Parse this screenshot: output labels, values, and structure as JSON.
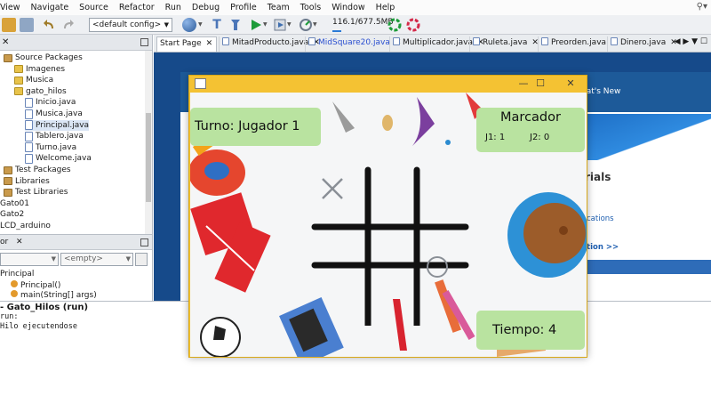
{
  "menu": [
    "View",
    "Navigate",
    "Source",
    "Refactor",
    "Run",
    "Debug",
    "Profile",
    "Team",
    "Tools",
    "Window",
    "Help"
  ],
  "toolbar": {
    "config": "<default config>",
    "memory": "116.1/677.5MB",
    "memory_fraction": 0.17
  },
  "projects_tree": [
    {
      "label": "Source Packages",
      "indent": 0,
      "icon": "folder-icon"
    },
    {
      "label": "Imagenes",
      "indent": 1,
      "icon": "package-icon"
    },
    {
      "label": "Musica",
      "indent": 1,
      "icon": "package-icon"
    },
    {
      "label": "gato_hilos",
      "indent": 1,
      "icon": "package-icon"
    },
    {
      "label": "Inicio.java",
      "indent": 2,
      "icon": "java-file-icon"
    },
    {
      "label": "Musica.java",
      "indent": 2,
      "icon": "java-file-icon"
    },
    {
      "label": "Principal.java",
      "indent": 2,
      "icon": "java-file-icon",
      "selected": true
    },
    {
      "label": "Tablero.java",
      "indent": 2,
      "icon": "java-file-icon"
    },
    {
      "label": "Turno.java",
      "indent": 2,
      "icon": "java-file-icon"
    },
    {
      "label": "Welcome.java",
      "indent": 2,
      "icon": "java-file-icon"
    },
    {
      "label": "Test Packages",
      "indent": 0,
      "icon": "folder-icon"
    },
    {
      "label": "Libraries",
      "indent": 0,
      "icon": "library-icon"
    },
    {
      "label": "Test Libraries",
      "indent": 0,
      "icon": "library-icon"
    },
    {
      "label": "Gato01",
      "indent": -1,
      "icon": ""
    },
    {
      "label": "Gato2",
      "indent": -1,
      "icon": ""
    },
    {
      "label": "LCD_arduino",
      "indent": -1,
      "icon": ""
    }
  ],
  "navigator": {
    "tab": "or",
    "filter": "<empty>",
    "items": [
      "Principal",
      "Principal()",
      "main(String[] args)"
    ]
  },
  "output": {
    "title": "- Gato_Hilos (run)",
    "lines": [
      "run:",
      "Hilo ejecutendose"
    ]
  },
  "editor_tabs": [
    {
      "label": "Start Page",
      "active": true
    },
    {
      "label": "MitadProducto.java"
    },
    {
      "label": "MidSquare20.java",
      "highlight": true
    },
    {
      "label": "Multiplicador.java"
    },
    {
      "label": "Ruleta.java"
    },
    {
      "label": "Preorden.java"
    },
    {
      "label": "Dinero.java"
    }
  ],
  "start_page": {
    "whats_new": "hat's New",
    "tutorials": "rials",
    "link1": "cations",
    "link2": "tion >>"
  },
  "game": {
    "turno": "Turno:  Jugador 1",
    "marcador_title": "Marcador",
    "j1": "J1:  1",
    "j2": "J2:  0",
    "tiempo": "Tiempo:  4",
    "board": [
      "X",
      "",
      "",
      "",
      "",
      "",
      "",
      "",
      "O"
    ]
  },
  "colors": {
    "window_title": "#f4c233",
    "label_bg": "#b9e3a0",
    "run_icon": "#1d9b3a"
  }
}
